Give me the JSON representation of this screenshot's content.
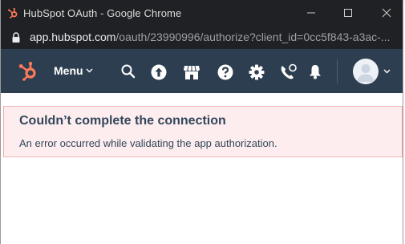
{
  "window": {
    "title": "HubSpot OAuth - Google Chrome"
  },
  "address_bar": {
    "host": "app.hubspot.com",
    "path": "/oauth/23990996/authorize?client_id=0cc5f843-a3ac-..."
  },
  "hubspot_nav": {
    "menu_label": "Menu",
    "icons": [
      "search-icon",
      "upgrade-icon",
      "marketplace-icon",
      "help-icon",
      "settings-icon",
      "calling-icon",
      "notifications-icon"
    ]
  },
  "alert": {
    "title": "Couldn’t complete the connection",
    "message": "An error occurred while validating the app authorization."
  },
  "colors": {
    "chrome_dark": "#202124",
    "hubspot_nav": "#2d3e50",
    "hubspot_orange": "#ff7a59",
    "alert_bg": "#fdedee",
    "alert_border": "#f2a7ab",
    "text_primary": "#33475b"
  }
}
